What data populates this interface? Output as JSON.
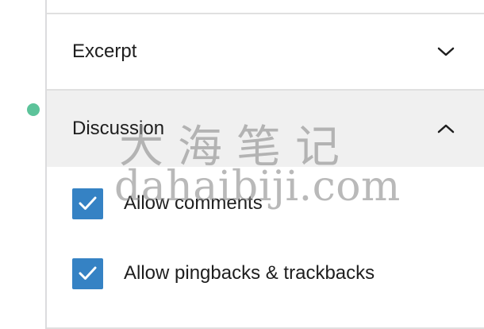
{
  "sections": {
    "excerpt": {
      "title": "Excerpt",
      "expanded": false
    },
    "discussion": {
      "title": "Discussion",
      "expanded": true,
      "options": [
        {
          "label": "Allow comments",
          "checked": true
        },
        {
          "label": "Allow pingbacks & trackbacks",
          "checked": true
        }
      ]
    }
  },
  "watermark": {
    "chinese": "大海笔记",
    "latin": "dahaibiji.com"
  },
  "colors": {
    "status_dot": "#5cc39a",
    "checkbox": "#3582c4",
    "active_section": "#f0f0f0",
    "text": "#1e1e1e"
  },
  "icons": {
    "excerpt_toggle": "chevron-down-icon",
    "discussion_toggle": "chevron-up-icon",
    "checkbox_mark": "check-icon"
  }
}
